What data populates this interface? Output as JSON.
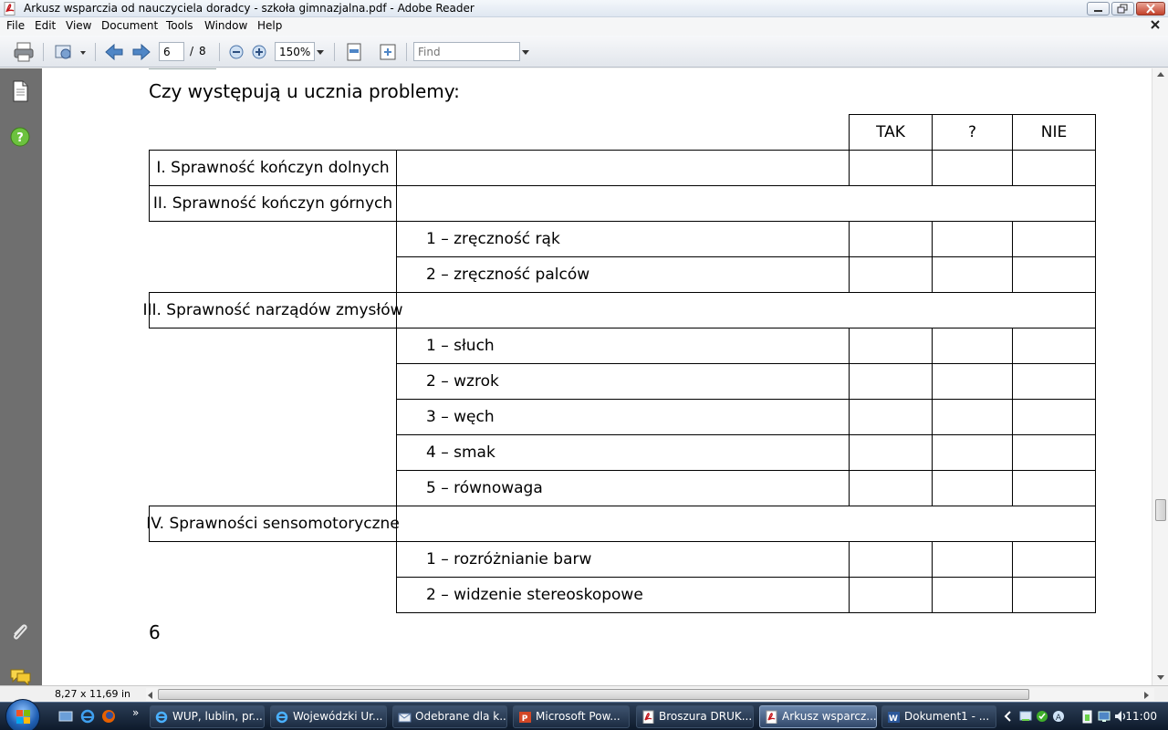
{
  "window": {
    "title": "Arkusz wsparczia od nauczyciela doradcy - szkoła gimnazjalna.pdf - Adobe Reader"
  },
  "menu": [
    "File",
    "Edit",
    "View",
    "Document",
    "Tools",
    "Window",
    "Help"
  ],
  "toolbar": {
    "current_page": "6",
    "page_separator": "/",
    "total_pages": "8",
    "zoom": "150%",
    "find_placeholder": "Find"
  },
  "document": {
    "heading": "Czy występują u ucznia problemy:",
    "columns": [
      "TAK",
      "?",
      "NIE"
    ],
    "sections": [
      {
        "label": "I. Sprawność kończyn dolnych",
        "items": []
      },
      {
        "label": "II. Sprawność kończyn górnych",
        "items": [
          "1 – zręczność rąk",
          "2 – zręczność palców"
        ]
      },
      {
        "label": "III. Sprawność narządów zmysłów",
        "items": [
          "1 – słuch",
          "2 – wzrok",
          "3 – węch",
          "4 – smak",
          "5 – równowaga"
        ]
      },
      {
        "label": "IV. Sprawności sensomotoryczne",
        "items": [
          "1 – rozróżnianie barw",
          "2 – widzenie stereoskopowe"
        ]
      }
    ],
    "page_number": "6"
  },
  "status": {
    "page_size": "8,27 x 11,69 in"
  },
  "taskbar": {
    "items": [
      {
        "label": "WUP, lublin, pr...",
        "icon": "ie-icon"
      },
      {
        "label": "Wojewódzki Ur...",
        "icon": "ie-icon"
      },
      {
        "label": "Odebrane dla k...",
        "icon": "mail-icon"
      },
      {
        "label": "Microsoft Pow...",
        "icon": "powerpoint-icon"
      },
      {
        "label": "Broszura DRUK....",
        "icon": "pdf-icon"
      },
      {
        "label": "Arkusz wsparcz...",
        "icon": "pdf-icon",
        "active": true
      },
      {
        "label": "Dokument1 - ...",
        "icon": "word-icon"
      }
    ],
    "clock": "11:00"
  }
}
